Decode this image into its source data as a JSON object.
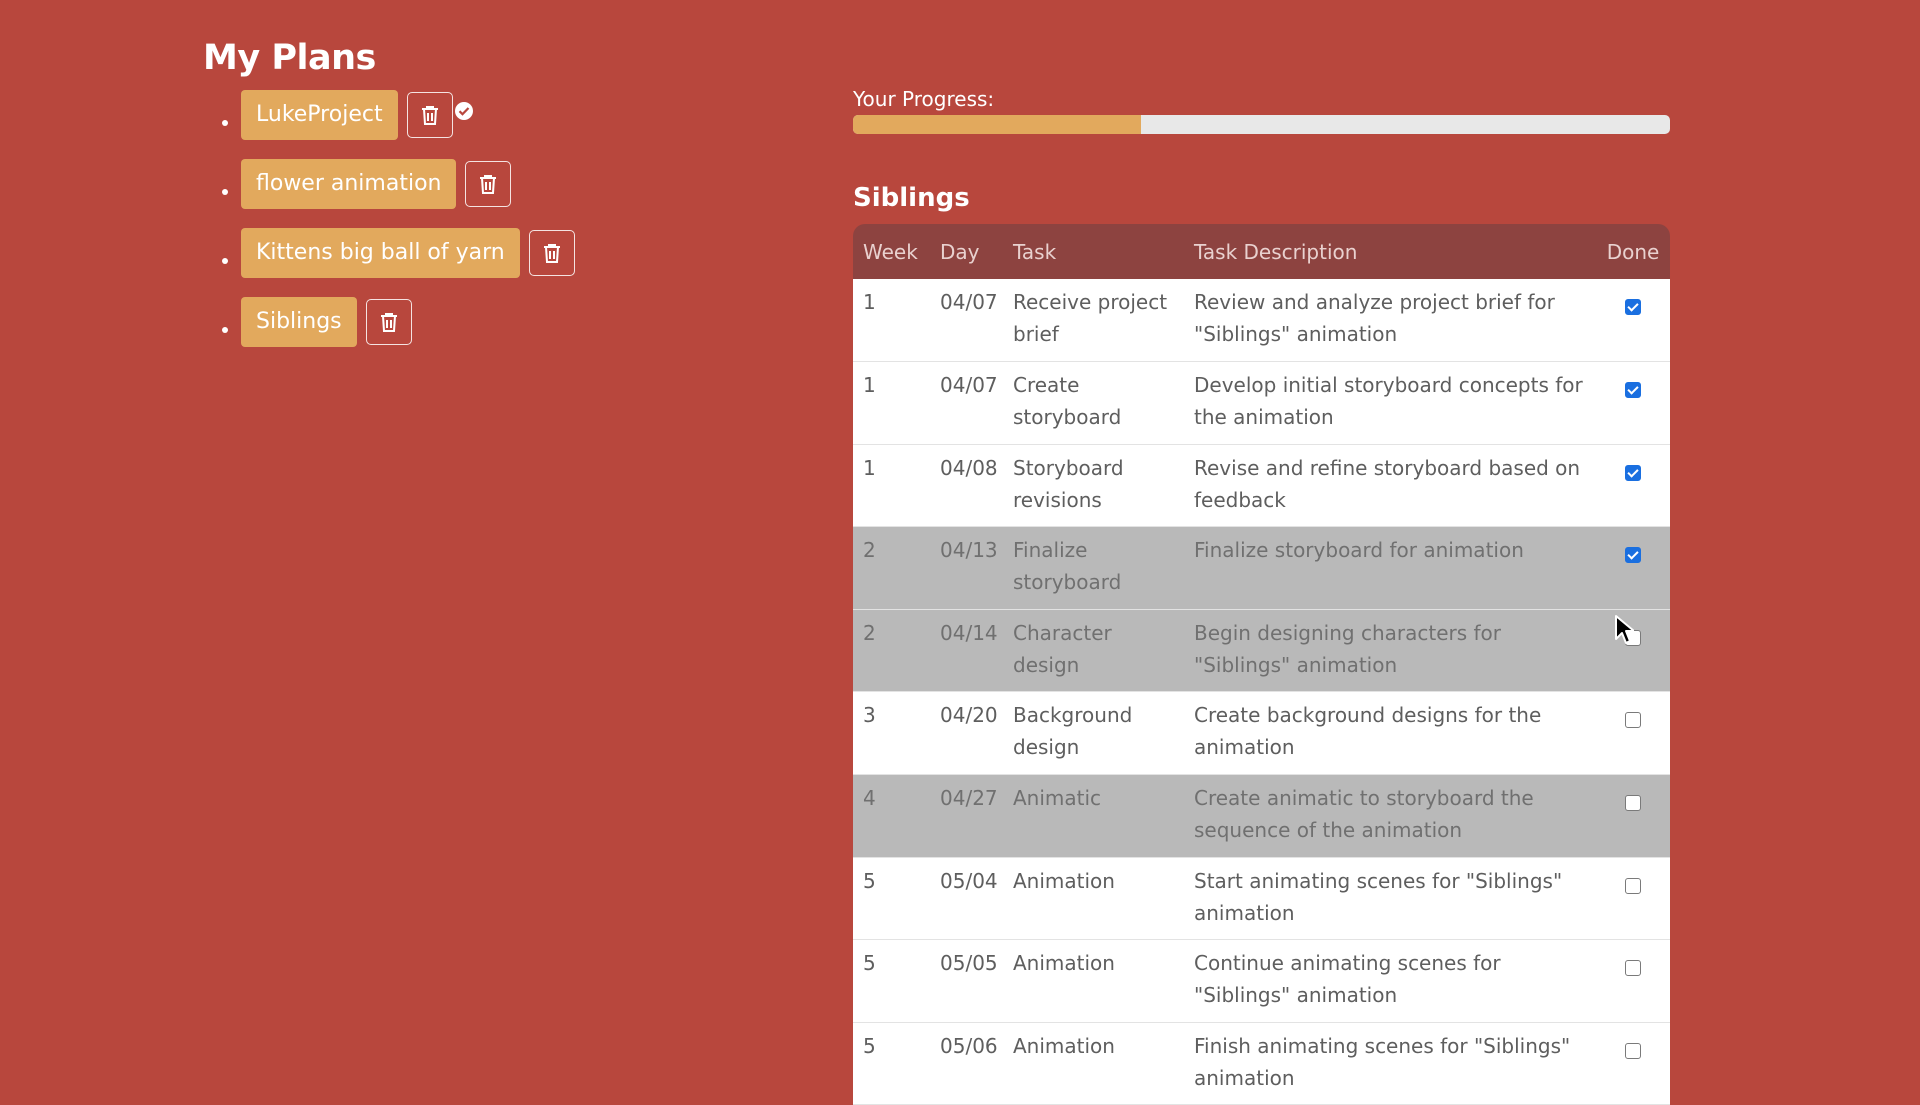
{
  "sidebar": {
    "title": "My Plans",
    "plans": [
      {
        "label": "LukeProject",
        "selected": true
      },
      {
        "label": "flower animation",
        "selected": false
      },
      {
        "label": "Kittens big ball of yarn",
        "selected": false
      },
      {
        "label": "Siblings",
        "selected": false
      }
    ],
    "delete_icon": "trash-icon",
    "selected_icon": "check-circle-icon"
  },
  "progress": {
    "label": "Your Progress:",
    "fraction": 0.353
  },
  "plan": {
    "title": "Siblings",
    "columns": [
      "Week",
      "Day",
      "Task",
      "Task Description",
      "Done"
    ],
    "rows": [
      {
        "week": "1",
        "day": "04/07",
        "task": "Receive project brief",
        "description": "Review and analyze project brief for \"Siblings\" animation",
        "done": true,
        "highlighted": false
      },
      {
        "week": "1",
        "day": "04/07",
        "task": "Create storyboard",
        "description": "Develop initial storyboard concepts for the animation",
        "done": true,
        "highlighted": false
      },
      {
        "week": "1",
        "day": "04/08",
        "task": "Storyboard revisions",
        "description": "Revise and refine storyboard based on feedback",
        "done": true,
        "highlighted": false
      },
      {
        "week": "2",
        "day": "04/13",
        "task": "Finalize storyboard",
        "description": "Finalize storyboard for animation",
        "done": true,
        "highlighted": true
      },
      {
        "week": "2",
        "day": "04/14",
        "task": "Character design",
        "description": "Begin designing characters for \"Siblings\" animation",
        "done": false,
        "highlighted": true
      },
      {
        "week": "3",
        "day": "04/20",
        "task": "Background design",
        "description": "Create background designs for the animation",
        "done": false,
        "highlighted": false
      },
      {
        "week": "4",
        "day": "04/27",
        "task": "Animatic",
        "description": "Create animatic to storyboard the sequence of the animation",
        "done": false,
        "highlighted": true
      },
      {
        "week": "5",
        "day": "05/04",
        "task": "Animation",
        "description": "Start animating scenes for \"Siblings\" animation",
        "done": false,
        "highlighted": false
      },
      {
        "week": "5",
        "day": "05/05",
        "task": "Animation",
        "description": "Continue animating scenes for \"Siblings\" animation",
        "done": false,
        "highlighted": false
      },
      {
        "week": "5",
        "day": "05/06",
        "task": "Animation",
        "description": "Finish animating scenes for \"Siblings\" animation",
        "done": false,
        "highlighted": false
      }
    ]
  },
  "colors": {
    "background": "#b8473d",
    "accent": "#e2a95d",
    "table_header": "#8d4340",
    "row_highlight": "#b9b9b9",
    "checkbox_checked": "#1a6fe0"
  }
}
